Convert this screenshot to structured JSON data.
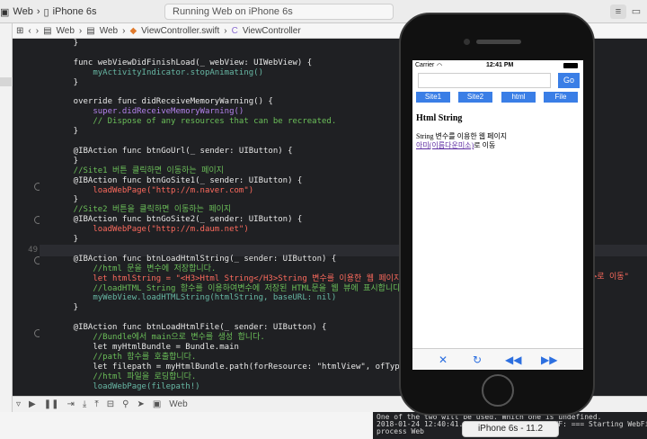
{
  "scheme": {
    "target": "Web",
    "device": "iPhone 6s"
  },
  "status": "Running Web on iPhone 6s",
  "jump": [
    "Web",
    "Web",
    "ViewController.swift",
    "ViewController"
  ],
  "gutter_lines": [
    "49"
  ],
  "code": [
    {
      "t": "    }",
      "c": "#e8e8e8"
    },
    {
      "t": "",
      "c": "#e8e8e8"
    },
    {
      "t": "    func webViewDidFinishLoad(_ webView: UIWebView) {",
      "c": "#e8e8e8"
    },
    {
      "t": "        myActivityIndicator.stopAnimating()",
      "c": "#67b7a4"
    },
    {
      "t": "    }",
      "c": "#e8e8e8"
    },
    {
      "t": "",
      "c": "#e8e8e8"
    },
    {
      "t": "    override func didReceiveMemoryWarning() {",
      "c": "#e8e8e8"
    },
    {
      "t": "        super.didReceiveMemoryWarning()",
      "c": "#b281eb"
    },
    {
      "t": "        // Dispose of any resources that can be recreated.",
      "c": "#6bbf59"
    },
    {
      "t": "    }",
      "c": "#e8e8e8"
    },
    {
      "t": "",
      "c": "#e8e8e8"
    },
    {
      "t": "    @IBAction func btnGoUrl(_ sender: UIButton) {",
      "c": "#e8e8e8"
    },
    {
      "t": "    }",
      "c": "#e8e8e8"
    },
    {
      "t": "    //Site1 버튼 클릭하면 이동하는 페이지",
      "c": "#6bbf59"
    },
    {
      "t": "    @IBAction func btnGoSite1(_ sender: UIButton) {",
      "c": "#e8e8e8"
    },
    {
      "t": "        loadWebPage(\"http://m.naver.com\")",
      "c": "#fc6a5d"
    },
    {
      "t": "    }",
      "c": "#e8e8e8"
    },
    {
      "t": "    //Site2 버튼을 클릭하면 이동하는 페이지",
      "c": "#6bbf59"
    },
    {
      "t": "    @IBAction func btnGoSite2(_ sender: UIButton) {",
      "c": "#e8e8e8"
    },
    {
      "t": "        loadWebPage(\"http://m.daum.net\")",
      "c": "#fc6a5d"
    },
    {
      "t": "    }",
      "c": "#e8e8e8"
    },
    {
      "t": "",
      "c": "#e8e8e8"
    },
    {
      "t": "    @IBAction func btnLoadHtmlString(_ sender: UIButton) {",
      "c": "#e8e8e8"
    },
    {
      "t": "        //html 문을 변수에 저장합니다.",
      "c": "#6bbf59"
    },
    {
      "t": "        let htmlString = \"<H3>Html String</H3>String 변수를 이용한 웹 페이지<BR /><a href",
      "c": "#fc6a5d"
    },
    {
      "t": "        //loadHTML String 함수를 이용하여변수에 저장된 HTML문을 웹 뷰에 표시합니다.",
      "c": "#6bbf59"
    },
    {
      "t": "        myWebView.loadHTMLString(htmlString, baseURL: nil)",
      "c": "#67b7a4"
    },
    {
      "t": "    }",
      "c": "#e8e8e8"
    },
    {
      "t": "",
      "c": "#e8e8e8"
    },
    {
      "t": "    @IBAction func btnLoadHtmlFile(_ sender: UIButton) {",
      "c": "#e8e8e8"
    },
    {
      "t": "        //Bundle에서 main으로 변수를 생성 합니다.",
      "c": "#6bbf59"
    },
    {
      "t": "        let myHtmlBundle = Bundle.main",
      "c": "#e8e8e8"
    },
    {
      "t": "        //path 함수를 호출합니다.",
      "c": "#6bbf59"
    },
    {
      "t": "        let filepath = myHtmlBundle.path(forResource: \"htmlView\", ofType: \"html\")",
      "c": "#e8e8e8"
    },
    {
      "t": "        //html 파일을 로딩합니다.",
      "c": "#6bbf59"
    },
    {
      "t": "        loadWebPage(filepath!)",
      "c": "#67b7a4"
    }
  ],
  "code_tail": "a\">로 이동\"",
  "debug": {
    "scheme": "Web"
  },
  "console": [
    "One of the two will be used. Which one is undefined.",
    "2018-01-24 12:40:41.9  WebView[2923:514] WF: === Starting WebFilter logging for",
    "process Web"
  ],
  "sim_title": "iPhone 6s - 11.2",
  "phone": {
    "carrier": "Carrier",
    "time": "12:41 PM",
    "go": "Go",
    "buttons": [
      "Site1",
      "Site2",
      "html",
      "File"
    ],
    "heading": "Html String",
    "body": "String 변수를 이용한 웹 페이지",
    "link": "아미(이름다운미소)",
    "link_tail": "로 이동"
  },
  "colors": {
    "accent": "#3a7ee6",
    "keyword": "#fc5fa3",
    "comment": "#6bbf59",
    "string": "#fc6a5d"
  }
}
